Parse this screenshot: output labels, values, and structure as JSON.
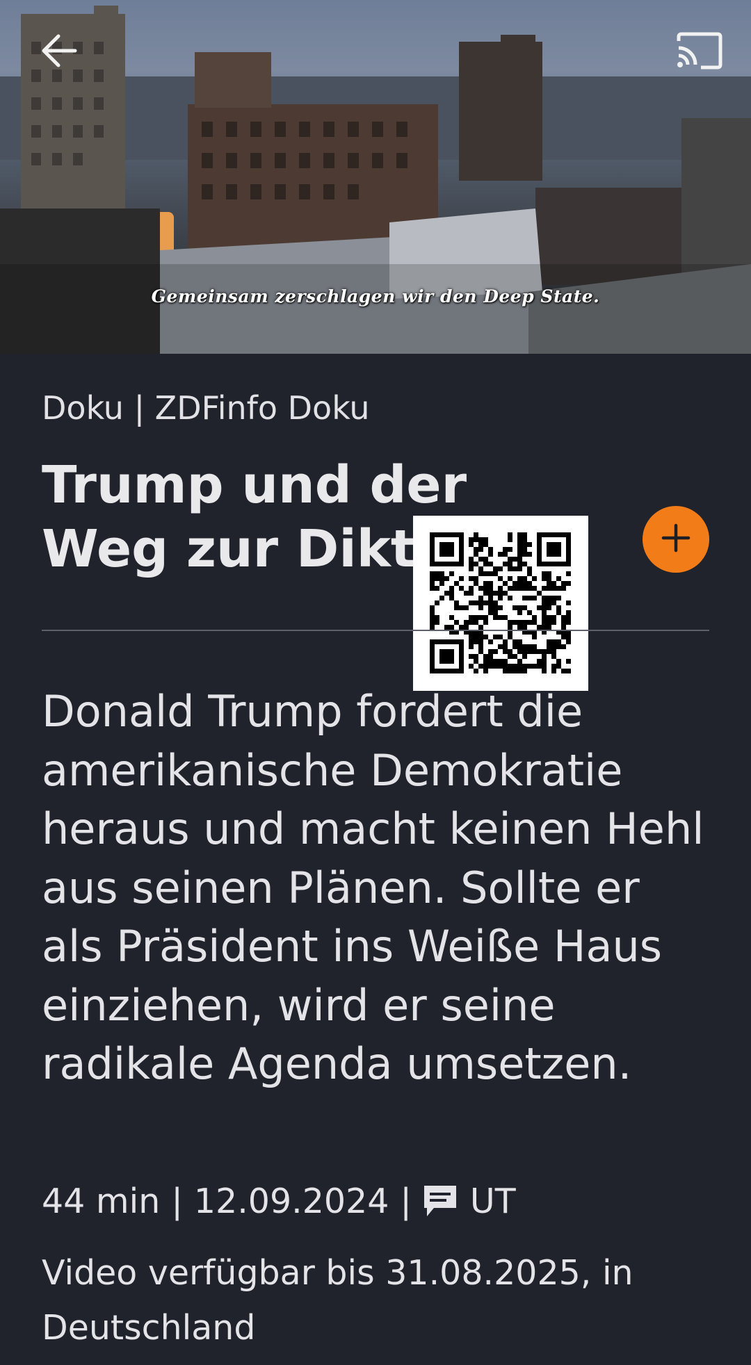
{
  "hero": {
    "subtitle_text": "Gemeinsam zerschlagen wir den Deep State.",
    "back_icon": "arrow-left-icon",
    "cast_icon": "cast-icon"
  },
  "content": {
    "category": "Doku | ZDFinfo Doku",
    "title": "Trump und der Weg zur Diktatur?",
    "add_icon": "plus-icon",
    "description": "Donald Trump fordert die amerikanische Demokratie heraus und macht keinen Hehl aus seinen Plänen. Sollte er als Präsident ins Weiße Haus einziehen, wird er seine radikale Agenda umsetzen.",
    "meta": {
      "duration": "44 min",
      "separator": "|",
      "date": "12.09.2024",
      "subtitles_icon": "subtitles-icon",
      "subtitles_label": "UT"
    },
    "availability": "Video verfügbar bis 31.08.2025, in Deutschland"
  },
  "colors": {
    "background": "#20232b",
    "accent": "#f27d18",
    "text": "#e4e4e8",
    "divider": "#5d6068"
  }
}
